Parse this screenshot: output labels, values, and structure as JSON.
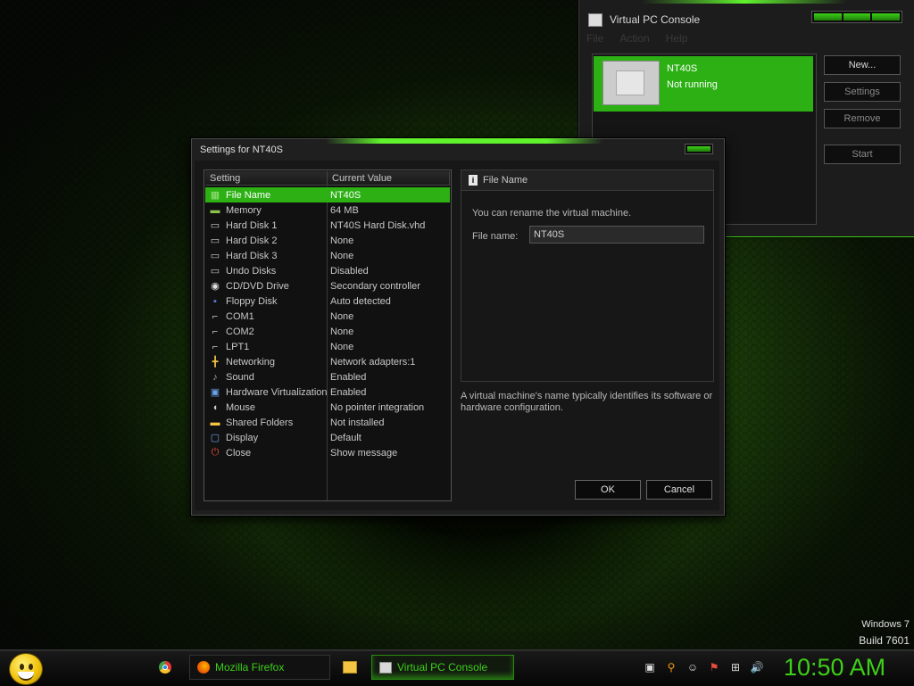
{
  "vpc_console": {
    "title": "Virtual PC Console",
    "menu": [
      "File",
      "Action",
      "Help"
    ],
    "vm": {
      "name": "NT40S",
      "state": "Not running"
    },
    "buttons": {
      "new": "New...",
      "settings": "Settings",
      "remove": "Remove",
      "start": "Start"
    }
  },
  "dialog": {
    "title": "Settings for NT40S",
    "columns": {
      "setting": "Setting",
      "current_value": "Current Value"
    },
    "rows": [
      {
        "icon": "file-icon",
        "name": "File Name",
        "value": "NT40S",
        "selected": true
      },
      {
        "icon": "memory-icon",
        "name": "Memory",
        "value": "64 MB"
      },
      {
        "icon": "hard-disk-icon",
        "name": "Hard Disk 1",
        "value": "NT40S Hard Disk.vhd"
      },
      {
        "icon": "hard-disk-icon",
        "name": "Hard Disk 2",
        "value": "None"
      },
      {
        "icon": "hard-disk-icon",
        "name": "Hard Disk 3",
        "value": "None"
      },
      {
        "icon": "undo-disk-icon",
        "name": "Undo Disks",
        "value": "Disabled"
      },
      {
        "icon": "cd-dvd-icon",
        "name": "CD/DVD Drive",
        "value": "Secondary controller"
      },
      {
        "icon": "floppy-icon",
        "name": "Floppy Disk",
        "value": "Auto detected"
      },
      {
        "icon": "com-port-icon",
        "name": "COM1",
        "value": "None"
      },
      {
        "icon": "com-port-icon",
        "name": "COM2",
        "value": "None"
      },
      {
        "icon": "lpt-port-icon",
        "name": "LPT1",
        "value": "None"
      },
      {
        "icon": "network-icon",
        "name": "Networking",
        "value": "Network adapters:1"
      },
      {
        "icon": "sound-icon",
        "name": "Sound",
        "value": "Enabled"
      },
      {
        "icon": "hardware-virtualization-icon",
        "name": "Hardware Virtualization",
        "value": "Enabled"
      },
      {
        "icon": "mouse-icon",
        "name": "Mouse",
        "value": "No pointer integration"
      },
      {
        "icon": "shared-folder-icon",
        "name": "Shared Folders",
        "value": "Not installed"
      },
      {
        "icon": "display-icon",
        "name": "Display",
        "value": "Default"
      },
      {
        "icon": "close-icon",
        "name": "Close",
        "value": "Show message"
      }
    ],
    "panel": {
      "header": "File Name",
      "description": "You can rename the virtual machine.",
      "field_label": "File name:",
      "field_value": "NT40S",
      "note": "A virtual machine's name typically identifies its software or hardware configuration."
    },
    "ok": "OK",
    "cancel": "Cancel"
  },
  "watermark": {
    "line1": "Windows 7",
    "line2": "Build 7601"
  },
  "taskbar": {
    "items": [
      {
        "label": "Mozilla Firefox"
      },
      {
        "label": "Virtual PC Console"
      }
    ],
    "clock": "10:50 AM"
  },
  "colors": {
    "accent": "#3ecf18",
    "selection": "#2cb014"
  }
}
